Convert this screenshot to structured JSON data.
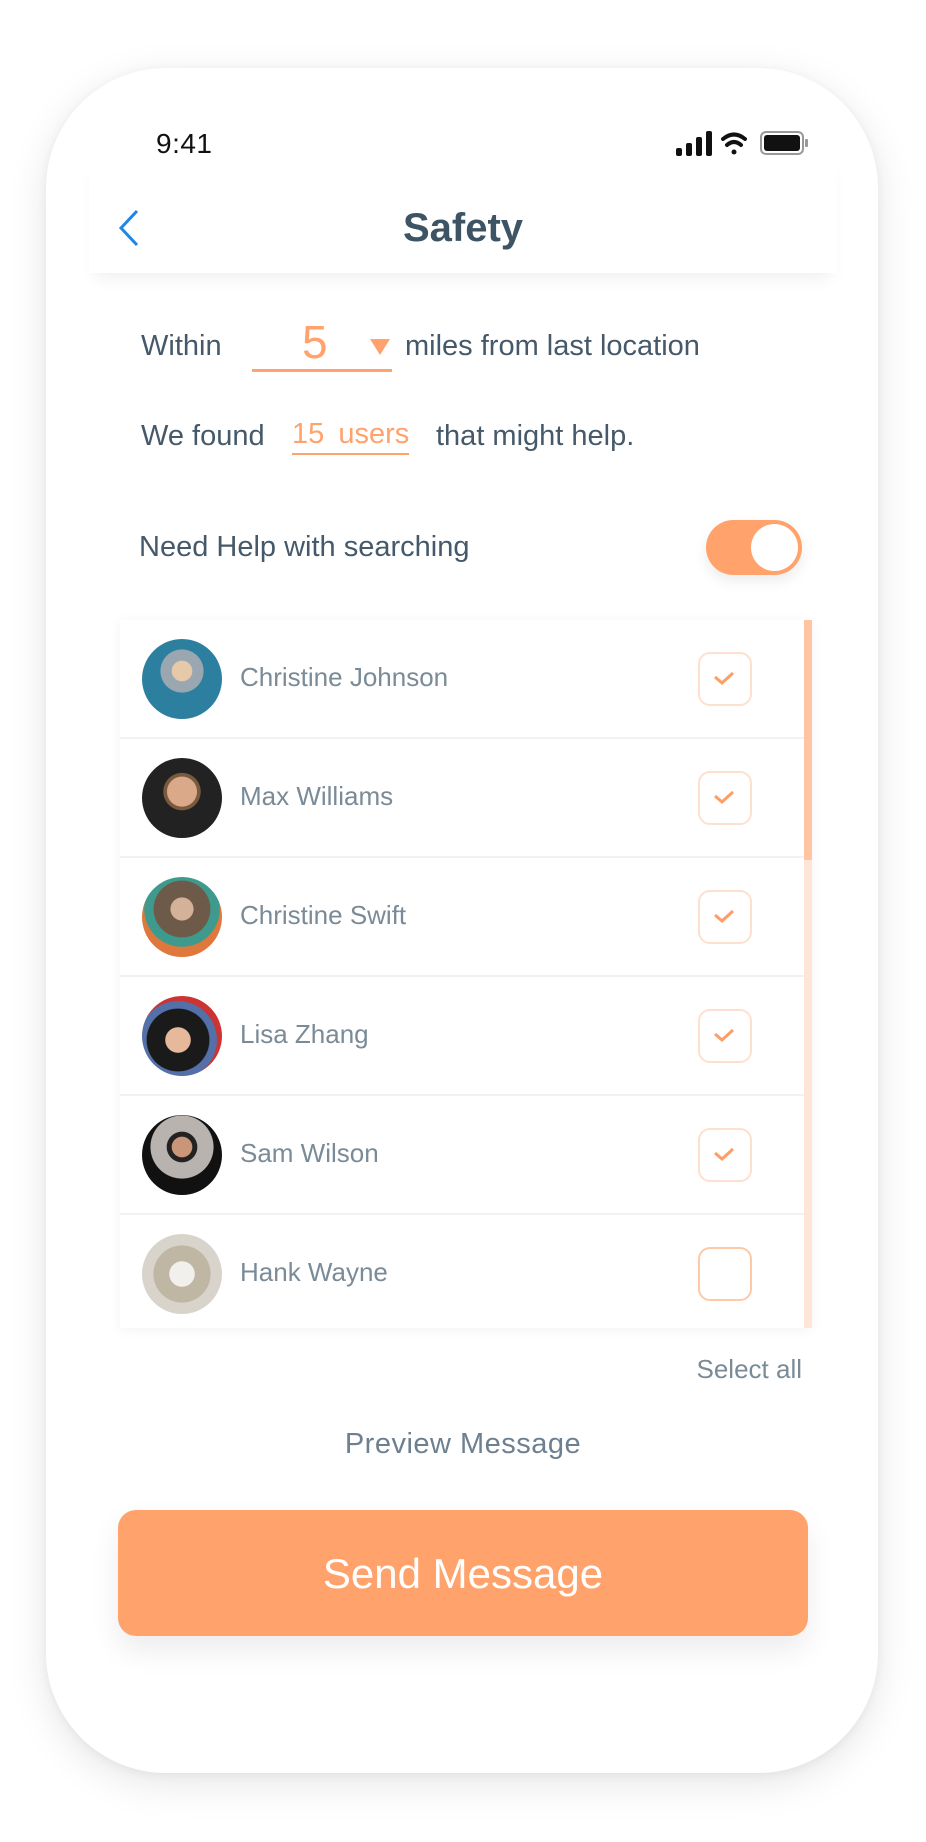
{
  "status_bar": {
    "time": "9:41",
    "icons": [
      "signal-icon",
      "wifi-icon",
      "battery-icon"
    ]
  },
  "header": {
    "title": "Safety",
    "back_icon": "chevron-left-icon"
  },
  "distance": {
    "prefix": "Within",
    "value": "5",
    "suffix": "miles from last location"
  },
  "found": {
    "prefix": "We found",
    "link": "15 users",
    "suffix": "that might help."
  },
  "help_toggle": {
    "label": "Need Help with searching",
    "on": true
  },
  "users": [
    {
      "name": "Christine Johnson",
      "checked": true
    },
    {
      "name": "Max Williams",
      "checked": true
    },
    {
      "name": "Christine Swift",
      "checked": true
    },
    {
      "name": "Lisa Zhang",
      "checked": true
    },
    {
      "name": "Sam Wilson",
      "checked": true
    },
    {
      "name": "Hank Wayne",
      "checked": false
    }
  ],
  "select_all": "Select all",
  "preview_label": "Preview Message",
  "send_label": "Send Message",
  "colors": {
    "accent": "#FFA26C",
    "text": "#45596A",
    "muted": "#7A8B97",
    "back": "#1E88E5"
  }
}
